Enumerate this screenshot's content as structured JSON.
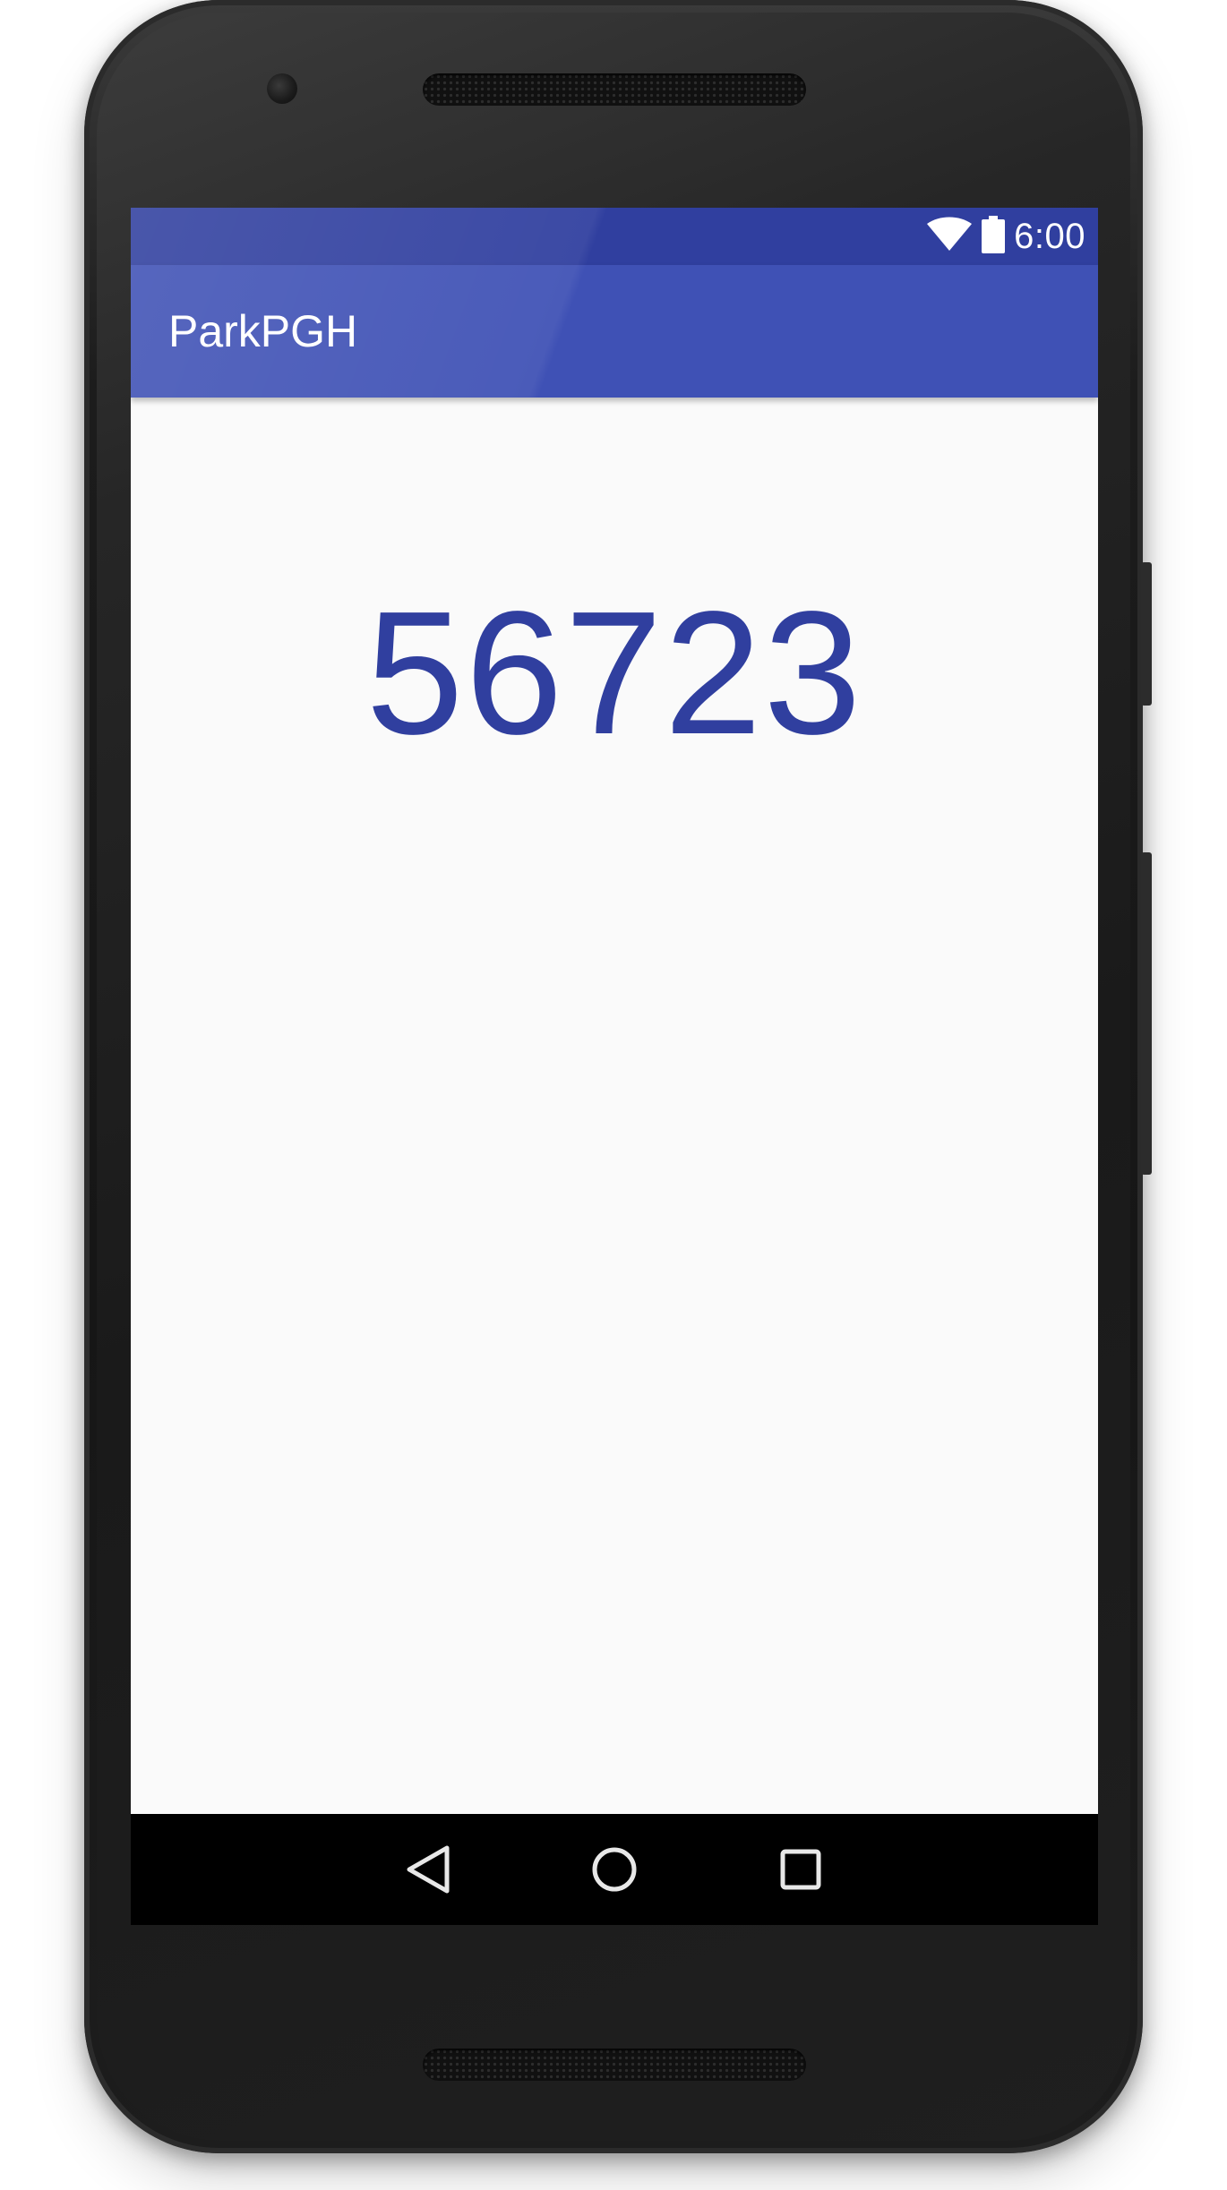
{
  "status_bar": {
    "time": "6:00",
    "icons": [
      "wifi-icon",
      "battery-icon"
    ],
    "color": "#303f9f"
  },
  "app_bar": {
    "title": "ParkPGH",
    "color": "#3f51b5"
  },
  "main": {
    "count": "56723",
    "count_color": "#303f9f"
  },
  "nav_bar": {
    "icons": [
      "back-icon",
      "home-icon",
      "recents-icon"
    ]
  }
}
